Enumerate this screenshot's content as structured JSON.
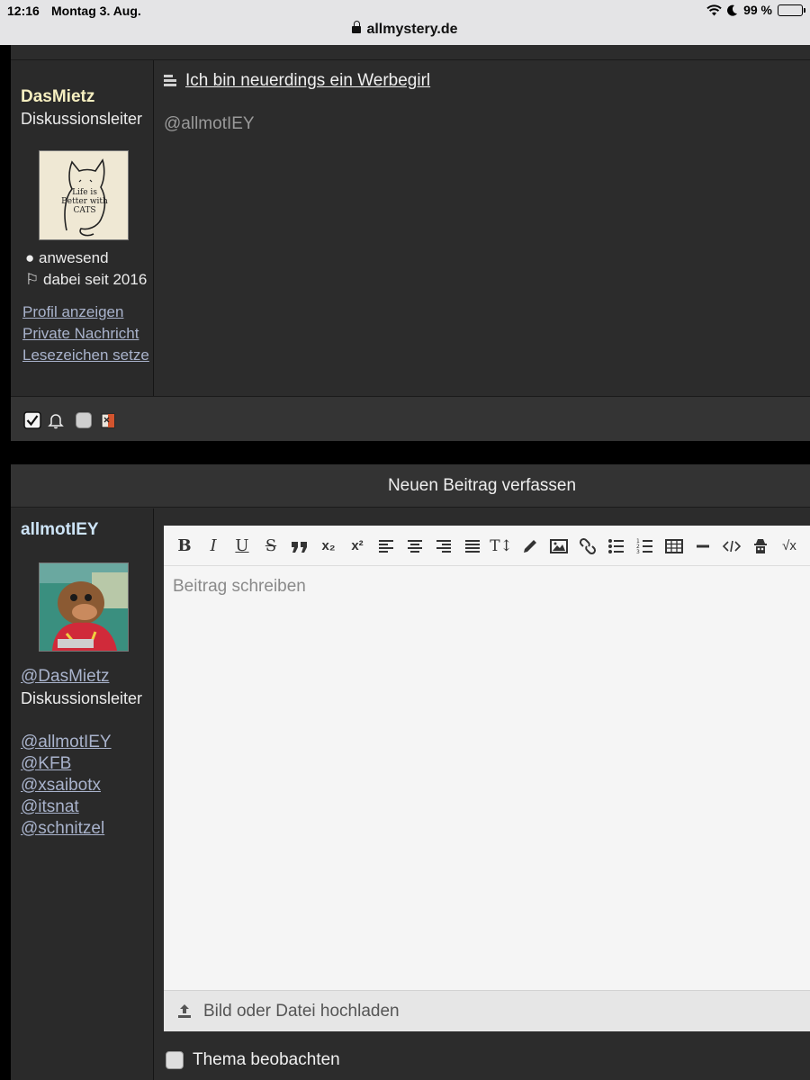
{
  "status_bar": {
    "time": "12:16",
    "date": "Montag 3. Aug.",
    "battery": "99 %"
  },
  "browser": {
    "url": "allmystery.de"
  },
  "post": {
    "author": "DasMietz",
    "rank": "Diskussionsleiter",
    "avatar_text": "Life is Better with CATS",
    "status": "anwesend",
    "member_since": "dabei seit 2016",
    "links": [
      "Profil anzeigen",
      "Private Nachricht",
      "Lesezeichen setze"
    ],
    "title": "Ich bin neuerdings ein Werbegirl",
    "body": "@allmotIEY"
  },
  "compose": {
    "header": "Neuen Beitrag verfassen",
    "author": "allmotIEY",
    "reply_to": "@DasMietz",
    "reply_to_rank": "Diskussionsleiter",
    "mentions": [
      "@allmotIEY",
      "@KFB",
      "@xsaibotx",
      "@itsnat",
      "@schnitzel"
    ],
    "toolbar": {
      "bold": "B",
      "italic": "I",
      "underline": "U",
      "strike": "S",
      "subscript": "x₂",
      "superscript": "x²",
      "text_size": "T↕",
      "sqrt": "√x"
    },
    "placeholder": "Beitrag schreiben",
    "upload_label": "Bild oder Datei hochladen",
    "watch_label": "Thema beobachten"
  },
  "colors": {
    "background": "#2c2c2c",
    "link": "#a9b3cc",
    "username_post": "#f6efc0",
    "username_compose": "#cde4f7"
  }
}
